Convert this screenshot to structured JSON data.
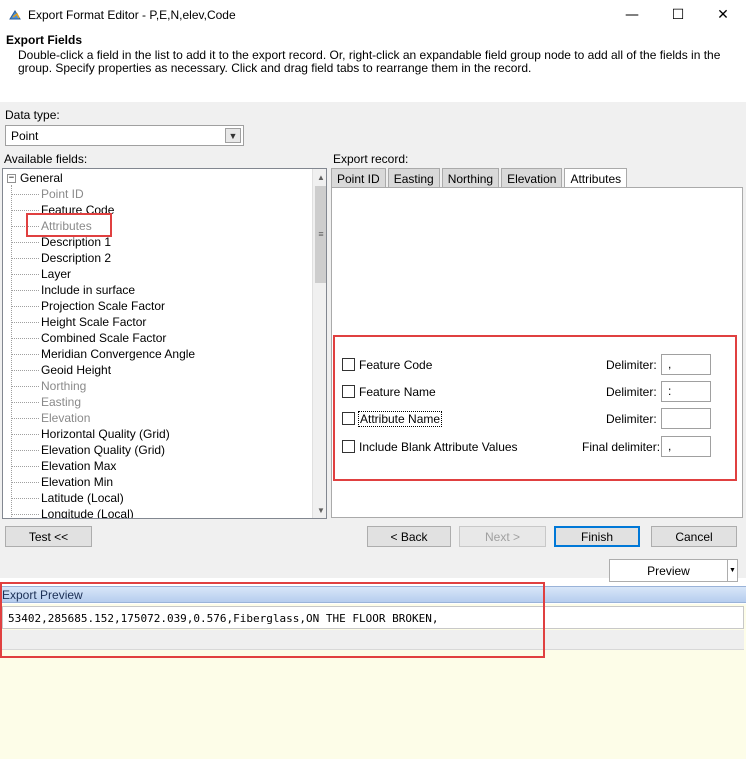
{
  "window": {
    "title": "Export Format Editor - P,E,N,elev,Code",
    "min_glyph": "—",
    "max_glyph": "☐",
    "close_glyph": "✕",
    "icon": "app-icon"
  },
  "header": {
    "title": "Export Fields",
    "description": "Double-click a field in the list to add it to the export record. Or, right-click an expandable field group node to add all of the fields in the group. Specify properties as necessary. Click and drag field tabs to rearrange them in the record."
  },
  "data_type": {
    "label": "Data type:",
    "value": "Point"
  },
  "available_fields": {
    "label": "Available fields:",
    "root": "General",
    "items": [
      {
        "label": "Point ID",
        "dim": true
      },
      {
        "label": "Feature Code",
        "dim": false
      },
      {
        "label": "Attributes",
        "dim": true
      },
      {
        "label": "Description 1",
        "dim": false
      },
      {
        "label": "Description 2",
        "dim": false
      },
      {
        "label": "Layer",
        "dim": false
      },
      {
        "label": "Include in surface",
        "dim": false
      },
      {
        "label": "Projection Scale Factor",
        "dim": false
      },
      {
        "label": "Height Scale Factor",
        "dim": false
      },
      {
        "label": "Combined Scale Factor",
        "dim": false
      },
      {
        "label": "Meridian Convergence Angle",
        "dim": false
      },
      {
        "label": "Geoid Height",
        "dim": false
      },
      {
        "label": "Northing",
        "dim": true
      },
      {
        "label": "Easting",
        "dim": true
      },
      {
        "label": "Elevation",
        "dim": true
      },
      {
        "label": "Horizontal Quality (Grid)",
        "dim": false
      },
      {
        "label": "Elevation Quality (Grid)",
        "dim": false
      },
      {
        "label": "Elevation Max",
        "dim": false
      },
      {
        "label": "Elevation Min",
        "dim": false
      },
      {
        "label": "Latitude (Local)",
        "dim": false
      },
      {
        "label": "Longitude (Local)",
        "dim": false
      }
    ]
  },
  "export_record": {
    "label": "Export record:",
    "tabs": [
      "Point ID",
      "Easting",
      "Northing",
      "Elevation",
      "Attributes"
    ],
    "active_tab": 4,
    "options": [
      {
        "label": "Feature Code",
        "delim_label": "Delimiter:",
        "delim_value": ","
      },
      {
        "label": "Feature Name",
        "delim_label": "Delimiter:",
        "delim_value": ":"
      },
      {
        "label": "Attribute Name",
        "delim_label": "Delimiter:",
        "delim_value": ""
      },
      {
        "label": "Include Blank Attribute Values",
        "delim_label": "Final delimiter:",
        "delim_value": ","
      }
    ]
  },
  "buttons": {
    "test": "Test <<",
    "back": "< Back",
    "next": "Next >",
    "finish": "Finish",
    "cancel": "Cancel",
    "preview": "Preview"
  },
  "preview": {
    "header": "Export Preview",
    "line": "53402,285685.152,175072.039,0.576,Fiberglass,ON THE FLOOR BROKEN,"
  },
  "colors": {
    "highlight": "#e04040",
    "accent": "#0078d7"
  }
}
